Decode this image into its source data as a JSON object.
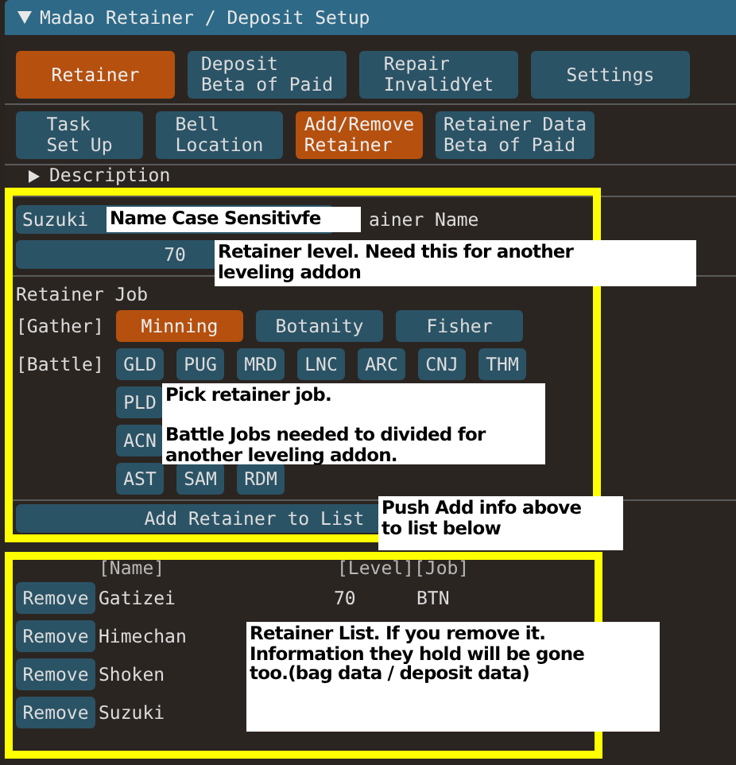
{
  "window": {
    "title": "Madao Retainer / Deposit Setup"
  },
  "main_tabs": [
    {
      "label": "Retainer",
      "selected": true
    },
    {
      "label": "Deposit\nBeta of Paid",
      "selected": false
    },
    {
      "label": "Repair\nInvalidYet",
      "selected": false
    },
    {
      "label": "Settings",
      "selected": false
    }
  ],
  "sub_tabs": [
    {
      "label": "Task\nSet Up",
      "selected": false
    },
    {
      "label": "Bell\nLocation",
      "selected": false
    },
    {
      "label": "Add/Remove\nRetainer",
      "selected": true
    },
    {
      "label": "Retainer Data\nBeta of Paid",
      "selected": false
    }
  ],
  "description": {
    "label": "Description",
    "expanded": false
  },
  "name_field": {
    "value": "Suzuki",
    "label": "ainer Name"
  },
  "level_field": {
    "value": "70"
  },
  "job_section": {
    "title": "Retainer Job",
    "gather_label": "[Gather]",
    "battle_label": "[Battle]",
    "gather_jobs": [
      {
        "label": "Minning",
        "selected": true
      },
      {
        "label": "Botanity",
        "selected": false
      },
      {
        "label": "Fisher",
        "selected": false
      }
    ],
    "battle_job_rows": [
      [
        {
          "label": "GLD",
          "selected": false
        },
        {
          "label": "PUG",
          "selected": false
        },
        {
          "label": "MRD",
          "selected": false
        },
        {
          "label": "LNC",
          "selected": false
        },
        {
          "label": "ARC",
          "selected": false
        },
        {
          "label": "CNJ",
          "selected": false
        },
        {
          "label": "THM",
          "selected": false
        }
      ],
      [
        {
          "label": "PLD",
          "selected": false
        }
      ],
      [
        {
          "label": "ACN",
          "selected": false
        }
      ],
      [
        {
          "label": "AST",
          "selected": false
        },
        {
          "label": "SAM",
          "selected": false
        },
        {
          "label": "RDM",
          "selected": false
        }
      ]
    ]
  },
  "add_button": "Add Retainer to List",
  "retainer_list": {
    "columns": [
      "[Name]",
      "[Level]",
      "[Job]"
    ],
    "rows": [
      {
        "action": "Remove",
        "name": "Gatizei",
        "level": "70",
        "job": "BTN"
      },
      {
        "action": "Remove",
        "name": "Himechan"
      },
      {
        "action": "Remove",
        "name": "Shoken"
      },
      {
        "action": "Remove",
        "name": "Suzuki"
      }
    ]
  },
  "annotations": [
    "Name Case Sensitivfe",
    "Retainer level. Need this for another leveling addon",
    "Pick retainer job.\n\nBattle Jobs needed to divided for another leveling addon.",
    "Push Add info above to list below",
    "Retainer List. If you remove it. Information they hold will be gone too.(bag data / deposit data)"
  ]
}
